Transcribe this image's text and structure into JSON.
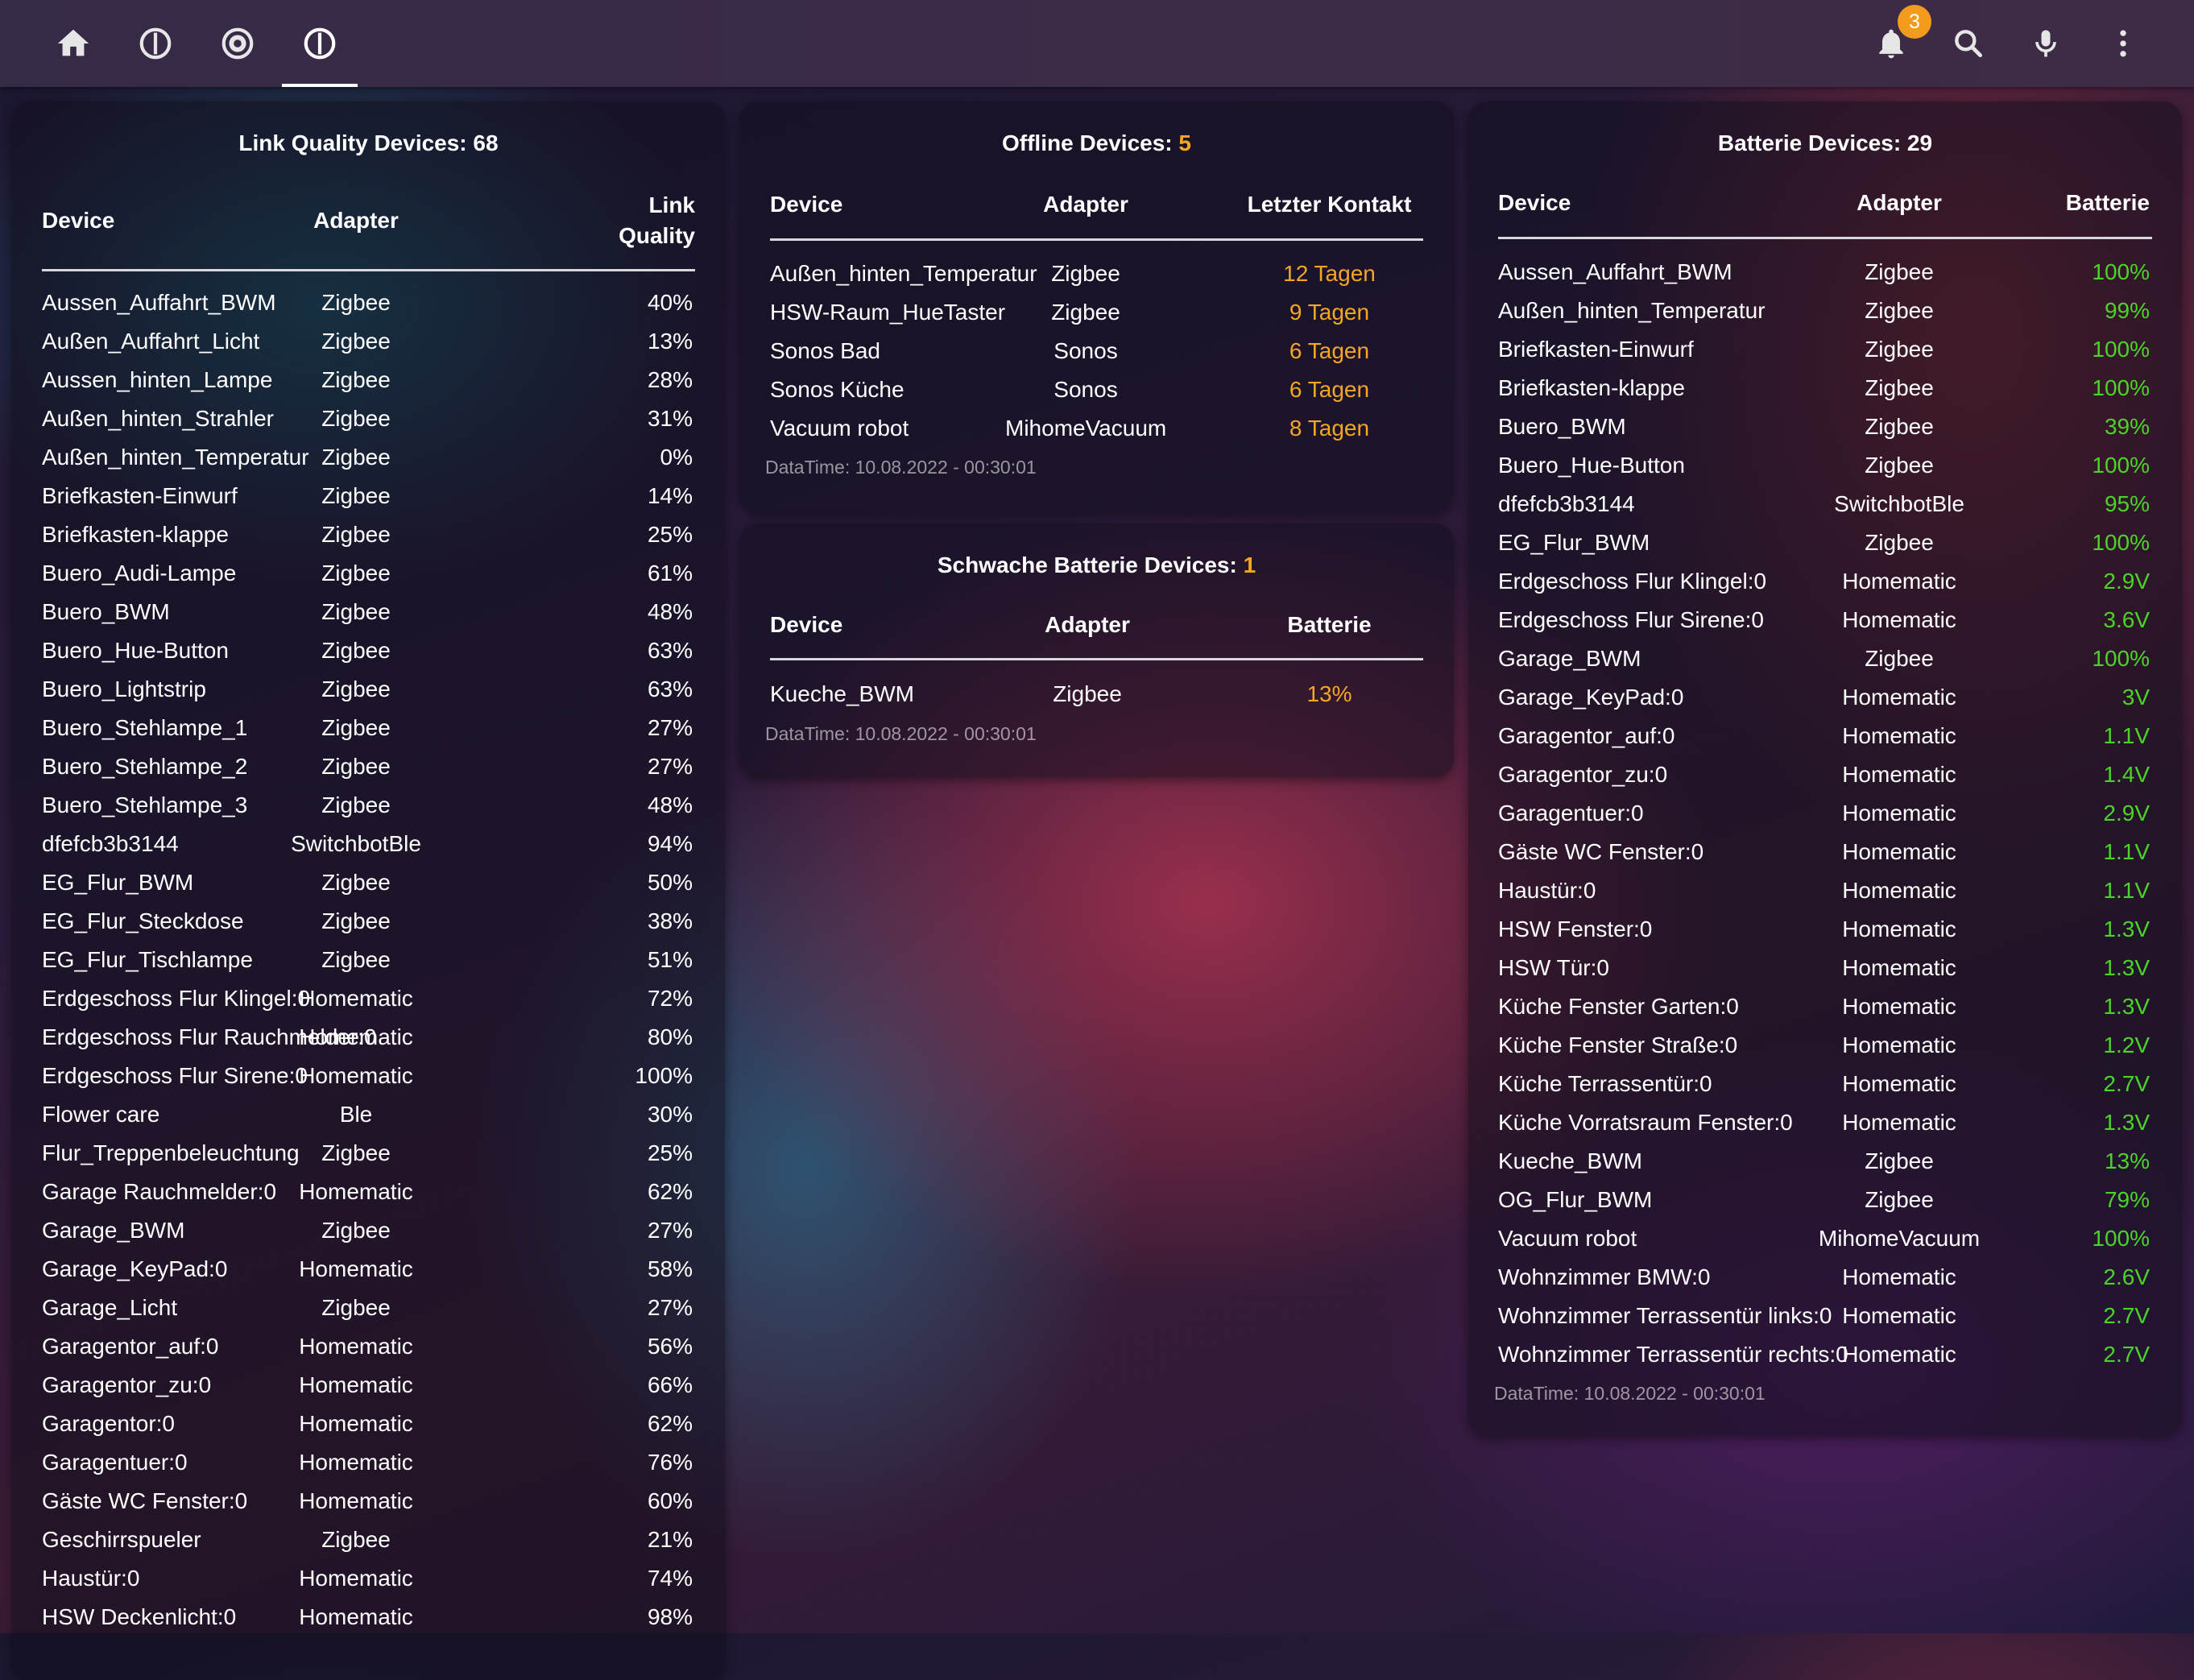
{
  "toolbar": {
    "tabs": [
      {
        "icon": "home-icon"
      },
      {
        "icon": "power-info-icon"
      },
      {
        "icon": "robot-vacuum-icon"
      },
      {
        "icon": "power-info-icon",
        "active": true
      }
    ],
    "notification_count": "3",
    "actions": [
      "bell-icon",
      "search-icon",
      "microphone-icon",
      "more-vert-icon"
    ]
  },
  "link_quality": {
    "title": "Link Quality Devices: 68",
    "headers": {
      "device": "Device",
      "adapter": "Adapter",
      "quality_line1": "Link",
      "quality_line2": "Quality"
    },
    "rows": [
      {
        "device": "Aussen_Auffahrt_BWM",
        "adapter": "Zigbee",
        "value": "40%"
      },
      {
        "device": "Außen_Auffahrt_Licht",
        "adapter": "Zigbee",
        "value": "13%"
      },
      {
        "device": "Aussen_hinten_Lampe",
        "adapter": "Zigbee",
        "value": "28%"
      },
      {
        "device": "Außen_hinten_Strahler",
        "adapter": "Zigbee",
        "value": "31%"
      },
      {
        "device": "Außen_hinten_Temperatur",
        "adapter": "Zigbee",
        "value": "0%"
      },
      {
        "device": "Briefkasten-Einwurf",
        "adapter": "Zigbee",
        "value": "14%"
      },
      {
        "device": "Briefkasten-klappe",
        "adapter": "Zigbee",
        "value": "25%"
      },
      {
        "device": "Buero_Audi-Lampe",
        "adapter": "Zigbee",
        "value": "61%"
      },
      {
        "device": "Buero_BWM",
        "adapter": "Zigbee",
        "value": "48%"
      },
      {
        "device": "Buero_Hue-Button",
        "adapter": "Zigbee",
        "value": "63%"
      },
      {
        "device": "Buero_Lightstrip",
        "adapter": "Zigbee",
        "value": "63%"
      },
      {
        "device": "Buero_Stehlampe_1",
        "adapter": "Zigbee",
        "value": "27%"
      },
      {
        "device": "Buero_Stehlampe_2",
        "adapter": "Zigbee",
        "value": "27%"
      },
      {
        "device": "Buero_Stehlampe_3",
        "adapter": "Zigbee",
        "value": "48%"
      },
      {
        "device": "dfefcb3b3144",
        "adapter": "SwitchbotBle",
        "value": "94%"
      },
      {
        "device": "EG_Flur_BWM",
        "adapter": "Zigbee",
        "value": "50%"
      },
      {
        "device": "EG_Flur_Steckdose",
        "adapter": "Zigbee",
        "value": "38%"
      },
      {
        "device": "EG_Flur_Tischlampe",
        "adapter": "Zigbee",
        "value": "51%"
      },
      {
        "device": "Erdgeschoss Flur Klingel:0",
        "adapter": "Homematic",
        "value": "72%"
      },
      {
        "device": "Erdgeschoss Flur Rauchmelder:0",
        "adapter": "Homematic",
        "value": "80%"
      },
      {
        "device": "Erdgeschoss Flur Sirene:0",
        "adapter": "Homematic",
        "value": "100%"
      },
      {
        "device": "Flower care",
        "adapter": "Ble",
        "value": "30%"
      },
      {
        "device": "Flur_Treppenbeleuchtung",
        "adapter": "Zigbee",
        "value": "25%"
      },
      {
        "device": "Garage Rauchmelder:0",
        "adapter": "Homematic",
        "value": "62%"
      },
      {
        "device": "Garage_BWM",
        "adapter": "Zigbee",
        "value": "27%"
      },
      {
        "device": "Garage_KeyPad:0",
        "adapter": "Homematic",
        "value": "58%"
      },
      {
        "device": "Garage_Licht",
        "adapter": "Zigbee",
        "value": "27%"
      },
      {
        "device": "Garagentor_auf:0",
        "adapter": "Homematic",
        "value": "56%"
      },
      {
        "device": "Garagentor_zu:0",
        "adapter": "Homematic",
        "value": "66%"
      },
      {
        "device": "Garagentor:0",
        "adapter": "Homematic",
        "value": "62%"
      },
      {
        "device": "Garagentuer:0",
        "adapter": "Homematic",
        "value": "76%"
      },
      {
        "device": "Gäste WC Fenster:0",
        "adapter": "Homematic",
        "value": "60%"
      },
      {
        "device": "Geschirrspueler",
        "adapter": "Zigbee",
        "value": "21%"
      },
      {
        "device": "Haustür:0",
        "adapter": "Homematic",
        "value": "74%"
      },
      {
        "device": "HSW Deckenlicht:0",
        "adapter": "Homematic",
        "value": "98%"
      }
    ]
  },
  "offline": {
    "title_label": "Offline Devices: ",
    "title_count": "5",
    "headers": {
      "device": "Device",
      "adapter": "Adapter",
      "value": "Letzter Kontakt"
    },
    "rows": [
      {
        "device": "Außen_hinten_Temperatur",
        "adapter": "Zigbee",
        "value": "12 Tagen"
      },
      {
        "device": "HSW-Raum_HueTaster",
        "adapter": "Zigbee",
        "value": "9 Tagen"
      },
      {
        "device": "Sonos Bad",
        "adapter": "Sonos",
        "value": "6 Tagen"
      },
      {
        "device": "Sonos Küche",
        "adapter": "Sonos",
        "value": "6 Tagen"
      },
      {
        "device": "Vacuum robot",
        "adapter": "MihomeVacuum",
        "value": "8 Tagen"
      }
    ],
    "datatime": "DataTime: 10.08.2022 - 00:30:01"
  },
  "weak_battery": {
    "title_label": "Schwache Batterie Devices: ",
    "title_count": "1",
    "headers": {
      "device": "Device",
      "adapter": "Adapter",
      "value": "Batterie"
    },
    "rows": [
      {
        "device": "Kueche_BWM",
        "adapter": "Zigbee",
        "value": "13%"
      }
    ],
    "datatime": "DataTime: 10.08.2022 - 00:30:01"
  },
  "battery": {
    "title": "Batterie Devices: 29",
    "headers": {
      "device": "Device",
      "adapter": "Adapter",
      "value": "Batterie"
    },
    "rows": [
      {
        "device": "Aussen_Auffahrt_BWM",
        "adapter": "Zigbee",
        "value": "100%"
      },
      {
        "device": "Außen_hinten_Temperatur",
        "adapter": "Zigbee",
        "value": "99%"
      },
      {
        "device": "Briefkasten-Einwurf",
        "adapter": "Zigbee",
        "value": "100%"
      },
      {
        "device": "Briefkasten-klappe",
        "adapter": "Zigbee",
        "value": "100%"
      },
      {
        "device": "Buero_BWM",
        "adapter": "Zigbee",
        "value": "39%"
      },
      {
        "device": "Buero_Hue-Button",
        "adapter": "Zigbee",
        "value": "100%"
      },
      {
        "device": "dfefcb3b3144",
        "adapter": "SwitchbotBle",
        "value": "95%"
      },
      {
        "device": "EG_Flur_BWM",
        "adapter": "Zigbee",
        "value": "100%"
      },
      {
        "device": "Erdgeschoss Flur Klingel:0",
        "adapter": "Homematic",
        "value": "2.9V"
      },
      {
        "device": "Erdgeschoss Flur Sirene:0",
        "adapter": "Homematic",
        "value": "3.6V"
      },
      {
        "device": "Garage_BWM",
        "adapter": "Zigbee",
        "value": "100%"
      },
      {
        "device": "Garage_KeyPad:0",
        "adapter": "Homematic",
        "value": "3V"
      },
      {
        "device": "Garagentor_auf:0",
        "adapter": "Homematic",
        "value": "1.1V"
      },
      {
        "device": "Garagentor_zu:0",
        "adapter": "Homematic",
        "value": "1.4V"
      },
      {
        "device": "Garagentuer:0",
        "adapter": "Homematic",
        "value": "2.9V"
      },
      {
        "device": "Gäste WC Fenster:0",
        "adapter": "Homematic",
        "value": "1.1V"
      },
      {
        "device": "Haustür:0",
        "adapter": "Homematic",
        "value": "1.1V"
      },
      {
        "device": "HSW Fenster:0",
        "adapter": "Homematic",
        "value": "1.3V"
      },
      {
        "device": "HSW Tür:0",
        "adapter": "Homematic",
        "value": "1.3V"
      },
      {
        "device": "Küche Fenster Garten:0",
        "adapter": "Homematic",
        "value": "1.3V"
      },
      {
        "device": "Küche Fenster Straße:0",
        "adapter": "Homematic",
        "value": "1.2V"
      },
      {
        "device": "Küche Terrassentür:0",
        "adapter": "Homematic",
        "value": "2.7V"
      },
      {
        "device": "Küche Vorratsraum Fenster:0",
        "adapter": "Homematic",
        "value": "1.3V"
      },
      {
        "device": "Kueche_BWM",
        "adapter": "Zigbee",
        "value": "13%"
      },
      {
        "device": "OG_Flur_BWM",
        "adapter": "Zigbee",
        "value": "79%"
      },
      {
        "device": "Vacuum robot",
        "adapter": "MihomeVacuum",
        "value": "100%"
      },
      {
        "device": "Wohnzimmer BMW:0",
        "adapter": "Homematic",
        "value": "2.6V"
      },
      {
        "device": "Wohnzimmer Terrassentür links:0",
        "adapter": "Homematic",
        "value": "2.7V"
      },
      {
        "device": "Wohnzimmer Terrassentür rechts:0",
        "adapter": "Homematic",
        "value": "2.7V"
      }
    ],
    "datatime": "DataTime: 10.08.2022 - 00:30:01"
  },
  "colors": {
    "warning": "#f5a623",
    "ok": "#4cd32a",
    "text": "#ffffff",
    "muted": "rgba(255,255,255,0.55)"
  }
}
